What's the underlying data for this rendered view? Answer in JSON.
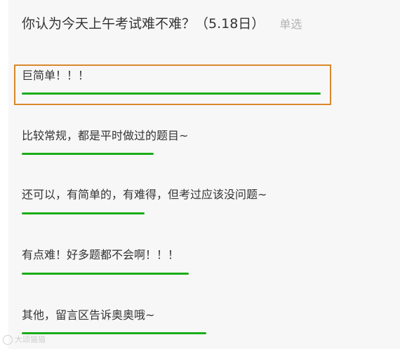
{
  "question": {
    "text": "你认为今天上午考试难不难？（5.18日）",
    "type_label": "单选"
  },
  "options": [
    {
      "label": "巨简单！！！",
      "share": 0.753,
      "selected": true
    },
    {
      "label": "比较常规，都是平时做过的题目~",
      "share": 0.332
    },
    {
      "label": "还可以，有简单的，有难得，但考过应该没问题~",
      "share": 0.31
    },
    {
      "label": "有点难！好多题都不会啊！！！",
      "share": 0.42
    },
    {
      "label": "其他，留言区告诉奥奥哦~",
      "share": 0.465
    }
  ],
  "colors": {
    "bar": "#1aad19",
    "highlight_border": "#d9882b"
  },
  "watermark": {
    "icon": "camera-logo-icon",
    "text": "大颂猫猫"
  }
}
